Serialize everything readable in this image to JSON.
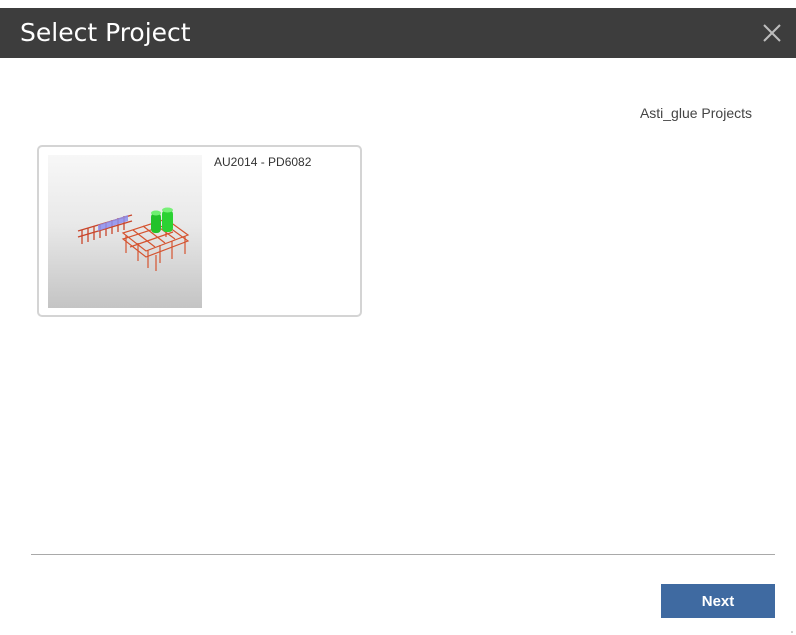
{
  "dialog": {
    "title": "Select Project",
    "close_icon": "close-icon"
  },
  "account": {
    "label": "Asti_glue Projects"
  },
  "projects": [
    {
      "name": "AU2014 - PD6082",
      "thumbnail_icon": "3d-model-thumbnail"
    }
  ],
  "footer": {
    "next_label": "Next"
  },
  "colors": {
    "titlebar": "#3d3d3d",
    "accent_button": "#3f6aa1",
    "card_border": "#d4d4d4",
    "divider": "#a9a9a9"
  }
}
